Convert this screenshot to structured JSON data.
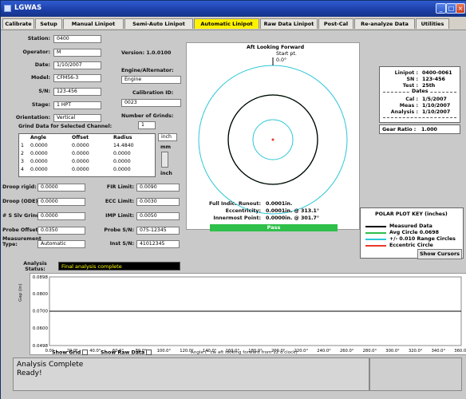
{
  "window": {
    "title": "LGWAS"
  },
  "tabs": [
    "Calibrate",
    "Setup",
    "Manual Linipot",
    "Semi-Auto Linipot",
    "Automatic Linipot",
    "Raw Data Linipot",
    "Post-Cal",
    "Re-analyze Data",
    "Utilities"
  ],
  "active_tab": "Automatic Linipot",
  "form": {
    "station_label": "Station:",
    "station": "0400",
    "operator_label": "Operator:",
    "operator": "M",
    "date_label": "Date:",
    "date": "1/10/2007",
    "model_label": "Model:",
    "model": "CFM56-3",
    "sn_label": "S/N:",
    "sn": "123-456",
    "stage_label": "Stage:",
    "stage": "1 HPT",
    "orientation_label": "Orientation:",
    "orientation": "Vertical",
    "version_label": "Version: 1.0.0100",
    "engine_label": "Engine/Alternator:",
    "engine": "Engine",
    "calibration_label": "Calibration ID:",
    "calibration": "0023",
    "num_grinds_label": "Number of Grinds:",
    "num_grinds": "1",
    "grind_data_label": "Grind Data for Selected Channel:"
  },
  "grind_table": {
    "headers": [
      "Angle",
      "Offset",
      "Radius"
    ],
    "rows": [
      [
        "1",
        "0.0000",
        "0.0000",
        "14.4840"
      ],
      [
        "2",
        "0.0000",
        "0.0000",
        "0.0000"
      ],
      [
        "3",
        "0.0000",
        "0.0000",
        "0.0000"
      ],
      [
        "4",
        "0.0000",
        "0.0000",
        "0.0000"
      ]
    ],
    "unit_top": "inch",
    "unit_mid": "mm",
    "unit_bottom": "inch"
  },
  "params": {
    "droop_rigid_label": "Droop rigid:",
    "droop_rigid": "0.0000",
    "droop_ode_label": "Droop (ODE):",
    "droop_ode": "0.0000",
    "slv_grind_label": "# S Slv Grind:",
    "slv_grind": "0.0000",
    "probe_offset_label": "Probe Offset:",
    "probe_offset": "0.0350",
    "meas_type_label": "Measurement Type:",
    "meas_type": "Automatic",
    "fir_limit_label": "FIR Limit:",
    "fir_limit": "0.0090",
    "ecc_limit_label": "ECC Limit:",
    "ecc_limit": "0.0030",
    "imp_limit_label": "IMP Limit:",
    "imp_limit": "0.0050",
    "probe_sn_label": "Probe S/N:",
    "probe_sn": "075-12345",
    "inst_sn_label": "Inst S/N:",
    "inst_sn": "41012345"
  },
  "polar": {
    "title": "Aft Looking Forward",
    "start_label": "Start pt.",
    "start_angle": "0.0°",
    "full_runout_label": "Full Indic. Runout:",
    "full_runout": "0.0001in.",
    "eccentricity_label": "Eccentricity:",
    "eccentricity": "0.0001in. @ 313.1°",
    "innermost_label": "Innermost Point:",
    "innermost": "0.0000in. @ 301.7°",
    "result": "Pass"
  },
  "info": {
    "linipot_label": "Linipot :",
    "linipot": "0400-0061",
    "sn_label": "SN :",
    "sn": "123-456",
    "test_label": "Test :",
    "test": "25th",
    "dates_label": "Dates",
    "cal_label": "Cal :",
    "cal": "1/5/2007",
    "meas_label": "Meas :",
    "meas": "1/10/2007",
    "analysis_label": "Analysis :",
    "analysis": "1/10/2007",
    "gear_label": "Gear Ratio :",
    "gear": "1.000"
  },
  "key": {
    "title": "POLAR PLOT KEY (inches)",
    "items": [
      {
        "label": "Measured Data",
        "color": "#000000"
      },
      {
        "label": "Avg Circle 0.0698",
        "color": "#2ec04a"
      },
      {
        "label": "+/- 0.010 Range Circles",
        "color": "#2cc6d6"
      },
      {
        "label": "Eccentric Circle",
        "color": "#e83a2a"
      }
    ]
  },
  "show_cursors": "Show Cursors",
  "analysis": {
    "label": "Analysis Status:",
    "status": "Final analysis complete"
  },
  "chart_data": {
    "type": "line",
    "xlabel": "Angle (° cw aft looking forward from 12 o'clock)",
    "ylabel": "Gap (in)",
    "ylim": [
      0.0498,
      0.0898
    ],
    "xlim": [
      0,
      360
    ],
    "yticks": [
      "0.0898",
      "0.0800",
      "0.0700",
      "0.0600",
      "0.0498"
    ],
    "ytick_values": [
      0.0898,
      0.08,
      0.07,
      0.06,
      0.0498
    ],
    "xticks": [
      "0.0°",
      "20.0°",
      "40.0°",
      "60.0°",
      "80.0°",
      "100.0°",
      "120.0°",
      "140.0°",
      "160.0°",
      "180.0°",
      "200.0°",
      "220.0°",
      "240.0°",
      "260.0°",
      "280.0°",
      "300.0°",
      "320.0°",
      "340.0°",
      "360.0°"
    ],
    "xtick_values": [
      0,
      20,
      40,
      60,
      80,
      100,
      120,
      140,
      160,
      180,
      200,
      220,
      240,
      260,
      280,
      300,
      320,
      340,
      360
    ],
    "series": [
      {
        "x": [
          0,
          360
        ],
        "values": [
          0.0698,
          0.0698
        ]
      }
    ],
    "grid": false
  },
  "chart_controls": {
    "show_grid": "Show Grid",
    "show_raw": "Show Raw Data"
  },
  "messages": {
    "line1": "Analysis Complete",
    "line2": "Ready!"
  }
}
